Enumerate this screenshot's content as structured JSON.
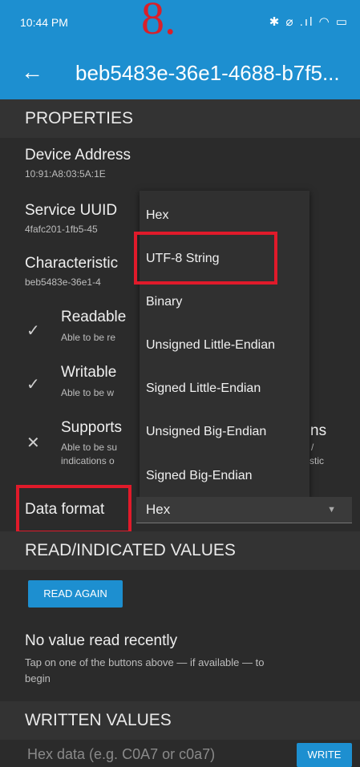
{
  "status_bar": {
    "time": "10:44 PM",
    "icons": "✱ ⌀ .ıl ◠ ▭"
  },
  "annotation": {
    "step_number": "8."
  },
  "app_bar": {
    "back_icon": "back-arrow",
    "title": "beb5483e-36e1-4688-b7f5..."
  },
  "properties_section": {
    "header": "PROPERTIES",
    "device_address": {
      "label": "Device Address",
      "value": "10:91:A8:03:5A:1E"
    },
    "service_uuid": {
      "label": "Service UUID",
      "value": "4fafc201-1fb5-45"
    },
    "characteristic": {
      "label": "Characteristic",
      "value": "beb5483e-36e1-4"
    },
    "items": [
      {
        "title": "Readable",
        "desc": "Able to be re",
        "icon": "check"
      },
      {
        "title": "Writable",
        "desc": "Able to be w",
        "icon": "check"
      },
      {
        "title": "Supports",
        "desc": "Able to be su",
        "desc2": "indications o",
        "icon": "cross",
        "tail1": "ns",
        "tail2": "/",
        "tail3": "stic"
      }
    ]
  },
  "dropdown": {
    "options": [
      "Hex",
      "UTF-8 String",
      "Binary",
      "Unsigned Little-Endian",
      "Signed Little-Endian",
      "Unsigned Big-Endian",
      "Signed Big-Endian"
    ]
  },
  "data_format": {
    "label": "Data format",
    "selected": "Hex"
  },
  "read_section": {
    "header": "READ/INDICATED VALUES",
    "read_again_label": "READ AGAIN",
    "no_value_title": "No value read recently",
    "no_value_desc_line1": "Tap on one of the buttons above — if available — to",
    "no_value_desc_line2": "begin"
  },
  "written_section": {
    "header": "WRITTEN VALUES",
    "input_placeholder": "Hex data (e.g. C0A7 or c0a7)",
    "write_label": "WRITE"
  },
  "colors": {
    "accent": "#1d8fd0",
    "highlight": "#e01a2a",
    "background": "#2b2b2b"
  }
}
